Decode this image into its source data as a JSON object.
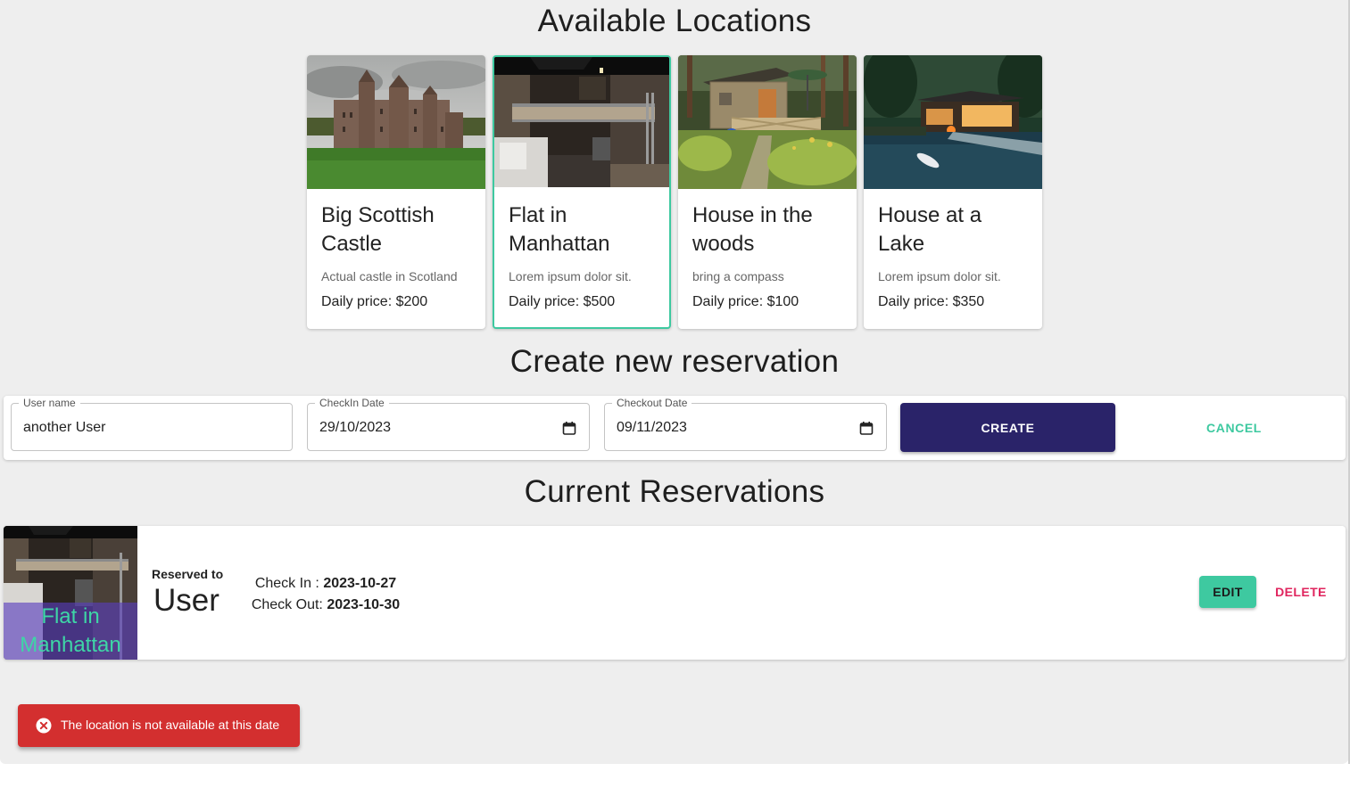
{
  "locations_heading": "Available Locations",
  "locations": [
    {
      "title": "Big Scottish Castle",
      "desc": "Actual castle in Scotland",
      "price": "Daily price: $200",
      "image": "castle-photo"
    },
    {
      "title": "Flat in Manhattan",
      "desc": "Lorem ipsum dolor sit.",
      "price": "Daily price: $500",
      "image": "flat-photo",
      "selected": true
    },
    {
      "title": "House in the woods",
      "desc": "bring a compass",
      "price": "Daily price: $100",
      "image": "cabin-photo"
    },
    {
      "title": "House at a Lake",
      "desc": "Lorem ipsum dolor sit.",
      "price": "Daily price: $350",
      "image": "lake-house-photo"
    }
  ],
  "form_heading": "Create new reservation",
  "form": {
    "username_label": "User name",
    "username_value": "another User",
    "checkin_label": "CheckIn Date",
    "checkin_value": "29/10/2023",
    "checkout_label": "Checkout Date",
    "checkout_value": "09/11/2023",
    "create_label": "CREATE",
    "cancel_label": "CANCEL",
    "calendar_icon": "calendar-icon"
  },
  "reservations_heading": "Current Reservations",
  "reservation": {
    "location": "Flat in Manhattan",
    "reserved_to_label": "Reserved to",
    "user": "User",
    "checkin_label": "Check In :",
    "checkin": "2023-10-27",
    "checkout_label": "Check Out:",
    "checkout": "2023-10-30",
    "edit_label": "EDIT",
    "delete_label": "DELETE"
  },
  "toast": {
    "message": "The location is not available at this date",
    "icon": "error-icon"
  },
  "colors": {
    "accent": "#3ec9a0",
    "primary": "#2a2369",
    "danger": "#e0245e",
    "toast": "#d32f2f"
  }
}
